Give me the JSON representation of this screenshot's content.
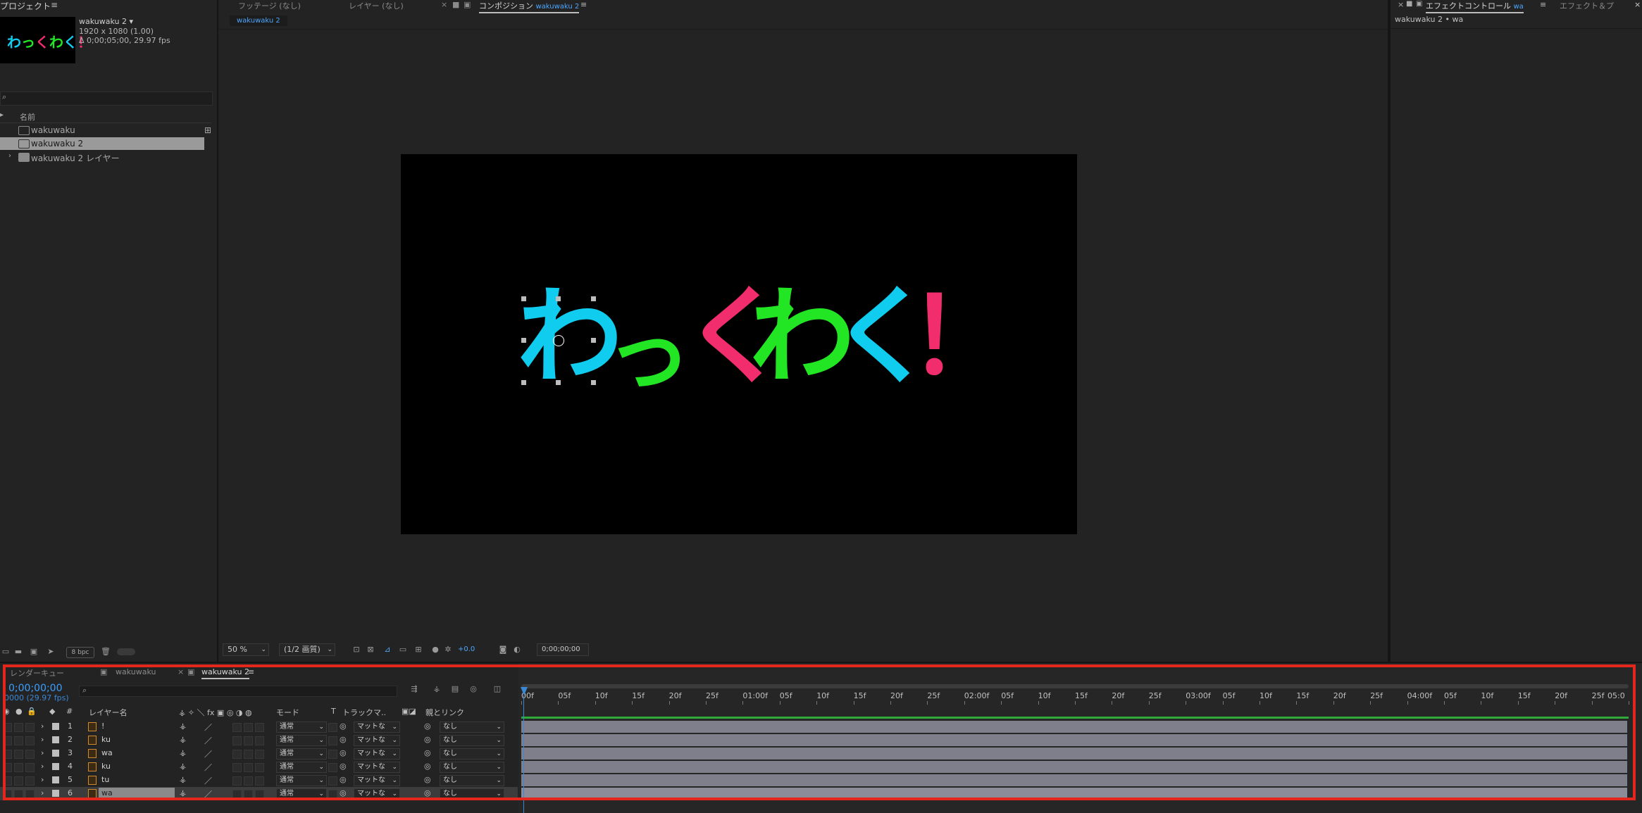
{
  "colors": {
    "text_cyan": "#10cdf0",
    "text_green": "#22e624",
    "text_pink": "#f22d6e",
    "accent_blue": "#3aa0ff",
    "highlight_frame": "#e3271d"
  },
  "project": {
    "title": "プロジェクト",
    "menu_icon": "≡",
    "thumb_text": "わっくわく！",
    "comp_name": "wakuwaku 2 ▾",
    "comp_info_1": "1920 x 1080 (1.00)",
    "comp_info_2": "Δ 0;00;05;00, 29.97 fps",
    "search_icon": "⌕",
    "column_name": "名前",
    "items": [
      {
        "label": "wakuwaku",
        "type": "comp-icon"
      },
      {
        "label": "wakuwaku 2",
        "type": "comp-icon"
      },
      {
        "label": "wakuwaku 2 レイヤー",
        "type": "folder-icon"
      }
    ],
    "bpc": "8 bpc"
  },
  "viewer": {
    "tab_footage": "フッテージ (なし)",
    "tab_layer": "レイヤー (なし)",
    "tab_close": "×",
    "tab_comp_label": "コンポジション",
    "tab_comp_name": "wakuwaku 2",
    "tab_menu": "≡",
    "sub_tab": "wakuwaku 2",
    "glyphs": [
      "わ",
      "っ",
      "く",
      "わ",
      "く",
      "！"
    ],
    "zoom": "50 %",
    "resolution": "(1/2 画質)",
    "exposure": "+0.0",
    "timecode": "0;00;00;00"
  },
  "effects": {
    "close": "×",
    "tab_effect_controls": "エフェクトコントロール",
    "tab_effect_controls_layer": "wa",
    "tab_menu": "≡",
    "tab_presets": "エフェクト＆プ",
    "panel_close": "×",
    "subtitle": "wakuwaku 2 • wa"
  },
  "timeline": {
    "tab_render": "レンダーキュー",
    "tab_wakuwaku": "wakuwaku",
    "tab_close": "×",
    "tab_wakuwaku2": "wakuwaku 2",
    "tab_menu": "≡",
    "timecode": "0;00;00;00",
    "fps": "0000 (29.97 fps)",
    "search_icon": "⌕",
    "headers": {
      "num": "#",
      "layer_name": "レイヤー名",
      "mode": "モード",
      "t": "T",
      "track_matte": "トラックマ..",
      "parent": "親とリンク"
    },
    "layers": [
      {
        "num": "1",
        "name": "!",
        "mode": "通常",
        "matte": "マットな",
        "parent": "なし"
      },
      {
        "num": "2",
        "name": "ku",
        "mode": "通常",
        "matte": "マットな",
        "parent": "なし"
      },
      {
        "num": "3",
        "name": "wa",
        "mode": "通常",
        "matte": "マットな",
        "parent": "なし"
      },
      {
        "num": "4",
        "name": "ku",
        "mode": "通常",
        "matte": "マットな",
        "parent": "なし"
      },
      {
        "num": "5",
        "name": "tu",
        "mode": "通常",
        "matte": "マットな",
        "parent": "なし"
      },
      {
        "num": "6",
        "name": "wa",
        "mode": "通常",
        "matte": "マットな",
        "parent": "なし"
      }
    ],
    "ruler_ticks": [
      "00f",
      "05f",
      "10f",
      "15f",
      "20f",
      "25f",
      "01:00f",
      "05f",
      "10f",
      "15f",
      "20f",
      "25f",
      "02:00f",
      "05f",
      "10f",
      "15f",
      "20f",
      "25f",
      "03:00f",
      "05f",
      "10f",
      "15f",
      "20f",
      "25f",
      "04:00f",
      "05f",
      "10f",
      "15f",
      "20f",
      "25f",
      "05:0"
    ]
  }
}
